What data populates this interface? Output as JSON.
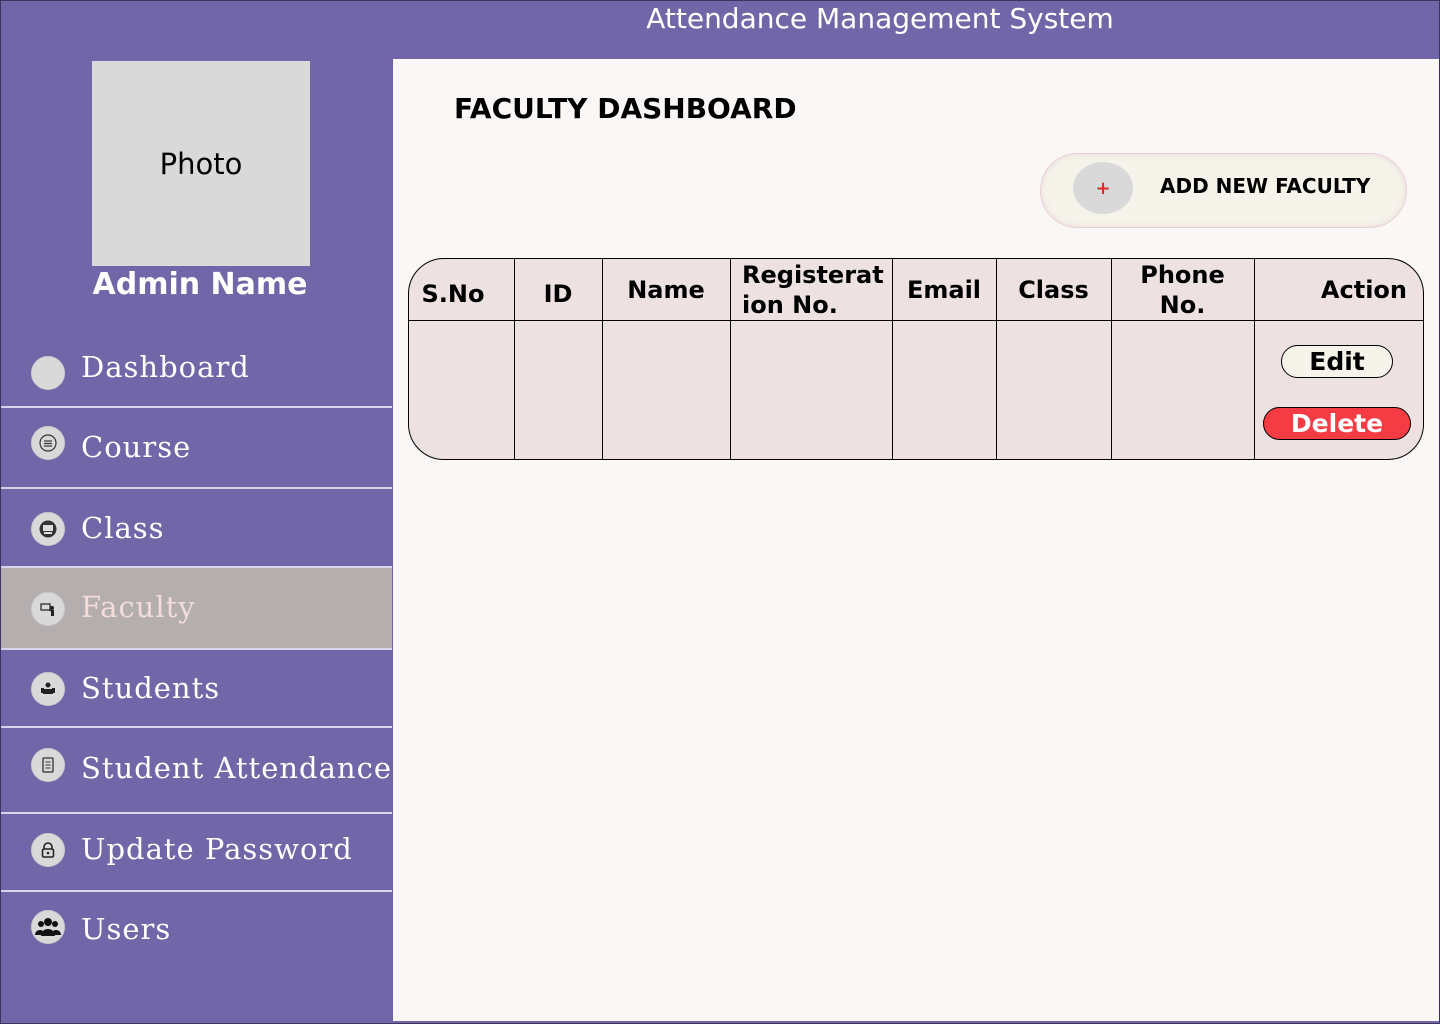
{
  "header": {
    "title": "Attendance Management System"
  },
  "profile": {
    "photo_label": "Photo",
    "admin_name": "Admin Name"
  },
  "sidebar": {
    "items": [
      {
        "label": "Dashboard",
        "icon": "circle-icon"
      },
      {
        "label": "Course",
        "icon": "list-icon"
      },
      {
        "label": "Class",
        "icon": "classroom-icon"
      },
      {
        "label": "Faculty",
        "icon": "teacher-icon",
        "active": true
      },
      {
        "label": "Students",
        "icon": "student-icon"
      },
      {
        "label": "Student Attendance",
        "icon": "document-icon"
      },
      {
        "label": "Update Password",
        "icon": "lock-icon"
      },
      {
        "label": "Users",
        "icon": "users-icon"
      }
    ]
  },
  "main": {
    "title": "FACULTY DASHBOARD",
    "add_button": {
      "icon_glyph": "+",
      "label": "ADD NEW FACULTY"
    },
    "table": {
      "columns": [
        "S.No",
        "ID",
        "Name",
        "Registerat ion No.",
        "Email",
        "Class",
        "Phone No.",
        "Action"
      ],
      "actions": {
        "edit": "Edit",
        "delete": "Delete"
      }
    }
  },
  "colors": {
    "sidebar_bg": "#7066a8",
    "main_bg": "#fbf7f6",
    "active_item_bg": "#b4aeae",
    "table_bg": "#ede1e2",
    "delete_bg": "#f53b44"
  }
}
